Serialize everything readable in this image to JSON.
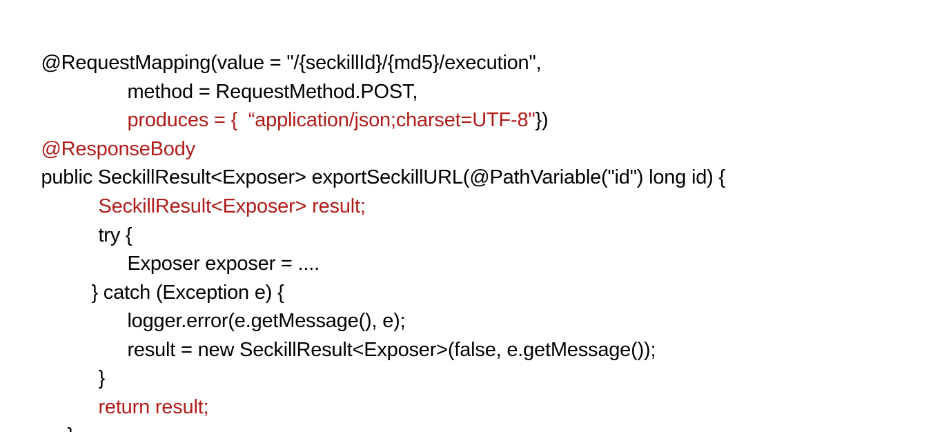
{
  "code_block": {
    "colors": {
      "default": "#000000",
      "highlight": "#b01c19"
    },
    "lines": [
      {
        "segments": [
          {
            "text": "@RequestMapping(value = \"/{seckillId}/{md5}/execution\",",
            "color": "default"
          }
        ]
      },
      {
        "segments": [
          {
            "text": "method = RequestMethod.POST,",
            "color": "default"
          }
        ]
      },
      {
        "segments": [
          {
            "text": "produces = {  “application/json;charset=UTF-8\"",
            "color": "highlight"
          },
          {
            "text": "})",
            "color": "default"
          }
        ]
      },
      {
        "segments": [
          {
            "text": "@ResponseBody",
            "color": "highlight"
          }
        ]
      },
      {
        "segments": [
          {
            "text": "public SeckillResult<Exposer> exportSeckillURL(@PathVariable(\"id\") long id) {",
            "color": "default"
          }
        ]
      },
      {
        "segments": [
          {
            "text": "SeckillResult<Exposer> result;",
            "color": "highlight"
          }
        ]
      },
      {
        "segments": [
          {
            "text": "try {",
            "color": "default"
          }
        ]
      },
      {
        "segments": [
          {
            "text": "Exposer exposer = ....",
            "color": "default"
          }
        ]
      },
      {
        "segments": [
          {
            "text": "} catch (Exception e) {",
            "color": "default"
          }
        ]
      },
      {
        "segments": [
          {
            "text": "logger.error(e.getMessage(), e);",
            "color": "default"
          }
        ]
      },
      {
        "segments": [
          {
            "text": "result = new SeckillResult<Exposer>(false, e.getMessage());",
            "color": "default"
          }
        ]
      },
      {
        "segments": [
          {
            "text": "}",
            "color": "default"
          }
        ]
      },
      {
        "segments": [
          {
            "text": "return result;",
            "color": "highlight"
          }
        ]
      },
      {
        "segments": [
          {
            "text": "}",
            "color": "default"
          }
        ]
      }
    ]
  }
}
